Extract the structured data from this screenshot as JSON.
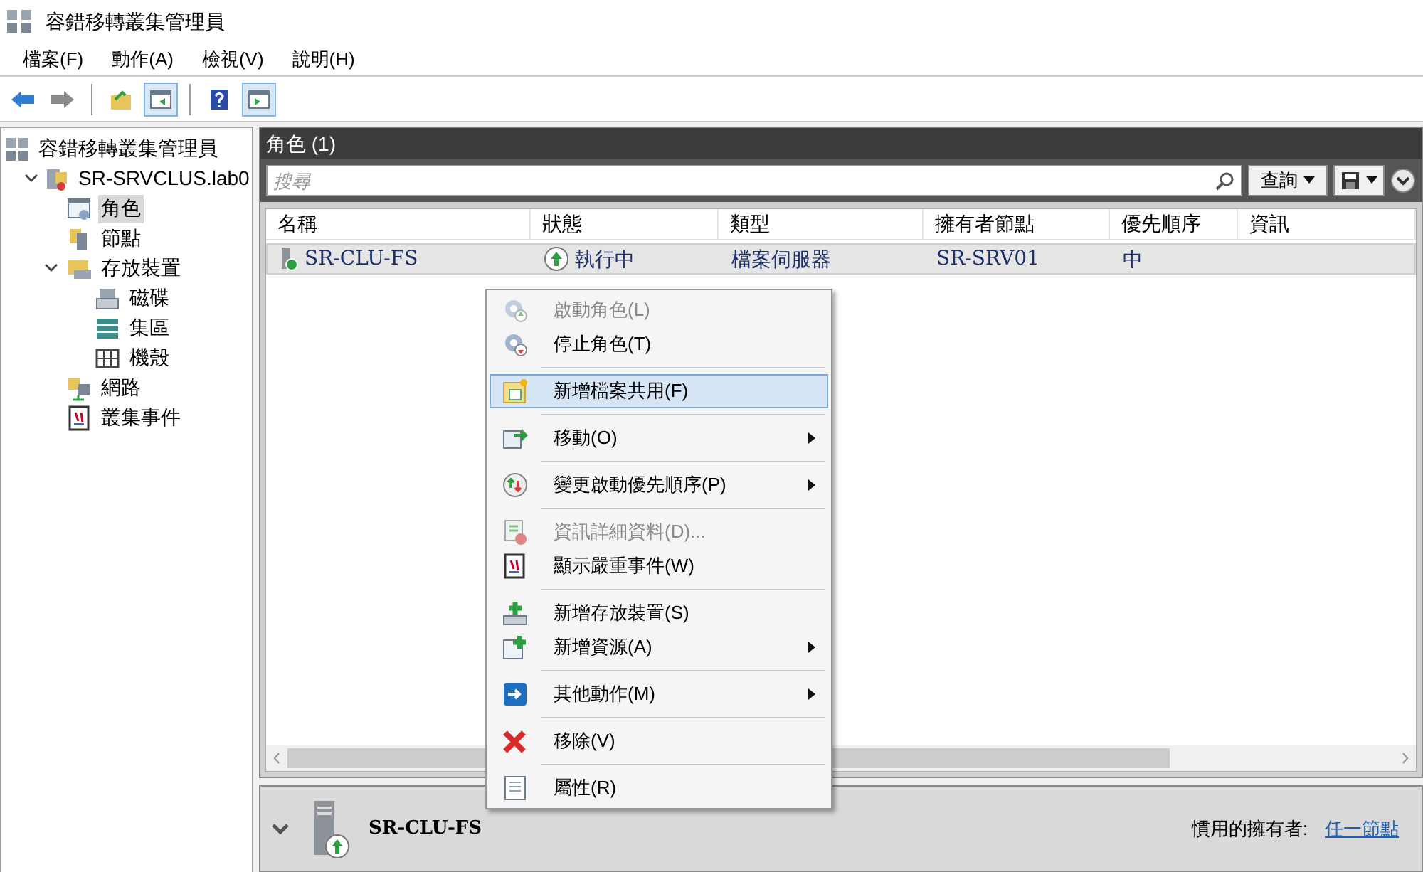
{
  "window": {
    "title": "容錯移轉叢集管理員"
  },
  "menu_bar": [
    "檔案(F)",
    "動作(A)",
    "檢視(V)",
    "說明(H)"
  ],
  "toolbar": [
    {
      "kind": "back",
      "pressed": false
    },
    {
      "kind": "forward",
      "pressed": false
    },
    {
      "kind": "sep"
    },
    {
      "kind": "up",
      "pressed": false
    },
    {
      "kind": "tree",
      "pressed": true
    },
    {
      "kind": "sep"
    },
    {
      "kind": "help",
      "pressed": false
    },
    {
      "kind": "pane",
      "pressed": true
    }
  ],
  "tree": [
    {
      "label": "容錯移轉叢集管理員",
      "kind": "cluster",
      "selected": false,
      "children": [
        {
          "label": "SR-SRVCLUS.lab0",
          "kind": "server",
          "selected": false,
          "expanded": true,
          "children": [
            {
              "label": "角色",
              "kind": "roles",
              "selected": true
            },
            {
              "label": "節點",
              "kind": "nodes",
              "selected": false
            },
            {
              "label": "存放裝置",
              "kind": "storage",
              "selected": false,
              "expanded": true,
              "children": [
                {
                  "label": "磁碟",
                  "kind": "disk",
                  "selected": false
                },
                {
                  "label": "集區",
                  "kind": "pool",
                  "selected": false
                },
                {
                  "label": "機殼",
                  "kind": "enclosure",
                  "selected": false
                }
              ]
            },
            {
              "label": "網路",
              "kind": "network",
              "selected": false
            },
            {
              "label": "叢集事件",
              "kind": "events",
              "selected": false
            }
          ]
        }
      ]
    }
  ],
  "roles_panel": {
    "title": "角色 (1)",
    "search": {
      "placeholder": "搜尋"
    },
    "query_button": "查詢",
    "table": {
      "columns": [
        "名稱",
        "狀態",
        "類型",
        "擁有者節點",
        "優先順序",
        "資訊"
      ],
      "rows": [
        {
          "selected": true,
          "cells": [
            "SR-CLU-FS",
            "執行中",
            "檔案伺服器",
            "SR-SRV01",
            "中",
            ""
          ]
        }
      ]
    }
  },
  "context_menu": [
    [
      {
        "label": "啟動角色(L)",
        "kind": "start",
        "disabled": true,
        "submenu": false,
        "highlighted": false
      },
      {
        "label": "停止角色(T)",
        "kind": "stop",
        "disabled": false,
        "submenu": false,
        "highlighted": false
      }
    ],
    [
      {
        "label": "新增檔案共用(F)",
        "kind": "share",
        "disabled": false,
        "submenu": false,
        "highlighted": true
      }
    ],
    [
      {
        "label": "移動(O)",
        "kind": "move",
        "disabled": false,
        "submenu": true,
        "highlighted": false
      }
    ],
    [
      {
        "label": "變更啟動優先順序(P)",
        "kind": "priority",
        "disabled": false,
        "submenu": true,
        "highlighted": false
      }
    ],
    [
      {
        "label": "資訊詳細資料(D)...",
        "kind": "info",
        "disabled": true,
        "submenu": false,
        "highlighted": false
      },
      {
        "label": "顯示嚴重事件(W)",
        "kind": "events",
        "disabled": false,
        "submenu": false,
        "highlighted": false
      }
    ],
    [
      {
        "label": "新增存放裝置(S)",
        "kind": "addstorage",
        "disabled": false,
        "submenu": false,
        "highlighted": false
      },
      {
        "label": "新增資源(A)",
        "kind": "addresource",
        "disabled": false,
        "submenu": true,
        "highlighted": false
      }
    ],
    [
      {
        "label": "其他動作(M)",
        "kind": "more",
        "disabled": false,
        "submenu": true,
        "highlighted": false
      }
    ],
    [
      {
        "label": "移除(V)",
        "kind": "remove",
        "disabled": false,
        "submenu": false,
        "highlighted": false
      }
    ],
    [
      {
        "label": "屬性(R)",
        "kind": "properties",
        "disabled": false,
        "submenu": false,
        "highlighted": false
      }
    ]
  ],
  "details": {
    "name": "SR-CLU-FS",
    "owners_label": "慣用的擁有者:",
    "owners_link": "任一節點"
  }
}
